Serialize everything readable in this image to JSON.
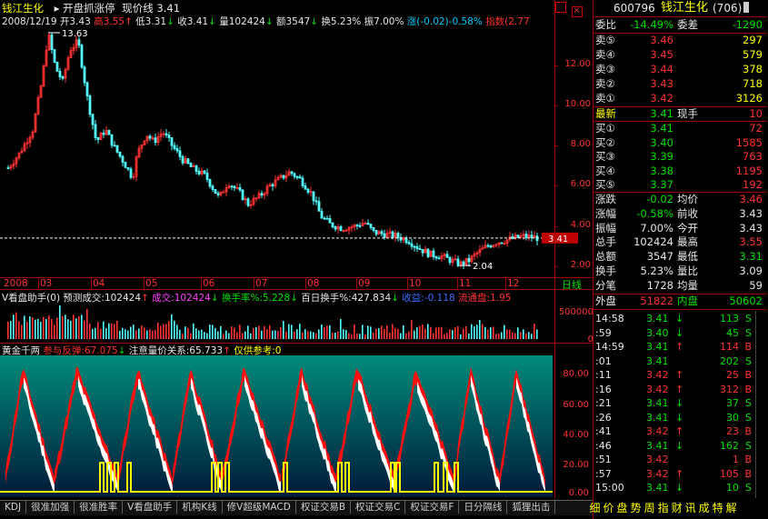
{
  "header": {
    "stock_name": "钱江生化",
    "indicator_name": "开盘抓涨停",
    "price_line_label": "现价线 3.41",
    "date": "2008/12/19",
    "open_label": "开3.43",
    "high_label": "高3.55",
    "low_label": "低3.31",
    "close_label": "收3.41",
    "volume_label": "量102424",
    "amount_label": "额3547",
    "turnover_label": "换5.23%",
    "amplitude_label": "振7.00%",
    "change_label": "涨(-0.02)-0.58%",
    "index_label": "指数(2.77"
  },
  "main_chart": {
    "high_annotation": "13.63",
    "low_annotation": "2.04",
    "current_price_tag": "3.41",
    "y_ticks": [
      "12.00",
      "10.00",
      "8.00",
      "6.00",
      "4.00",
      "2.00"
    ],
    "x_labels": [
      "2008",
      "03",
      "04",
      "05",
      "06",
      "07",
      "08",
      "09",
      "10",
      "11",
      "12"
    ],
    "period_label": "日线"
  },
  "volume_panel": {
    "title": "V看盘助手(0)",
    "items": [
      {
        "text": "预测成交:102424",
        "color": "#e8e8e8",
        "arrow": "↑"
      },
      {
        "text": "成交:102424",
        "color": "#ff40ff",
        "arrow": "↓"
      },
      {
        "text": "换手率%:5.228",
        "color": "#00e000",
        "arrow": "↓"
      },
      {
        "text": "百日换手%:427.834",
        "color": "#e8e8e8",
        "arrow": "↓"
      },
      {
        "text": "收益:-0.118",
        "color": "#3c6cff",
        "arrow": ""
      },
      {
        "text": "流通盘:1.95",
        "color": "#ff3232",
        "arrow": ""
      }
    ],
    "y_ticks": [
      "500000",
      "0"
    ]
  },
  "indicator_panel": {
    "title": "黄金千两",
    "items": [
      {
        "text": "参与反弹:67.075",
        "color": "#ff3232",
        "arrow": "↓"
      },
      {
        "text": "注意量价关系:65.733",
        "color": "#e8e8e8",
        "arrow": "↑"
      },
      {
        "text": "仅供参考:0",
        "color": "#ffff00",
        "arrow": ""
      }
    ],
    "y_ticks": [
      "80.00",
      "60.00",
      "40.00",
      "20.00",
      "0.00"
    ]
  },
  "bottom_tabs": [
    "KDJ",
    "很准加强",
    "很准胜率",
    "V看盘助手",
    "机构K线",
    "修V超级MACD",
    "权证交易B",
    "权证交易C",
    "权证交易F",
    "日分隔线",
    "狐狸出击"
  ],
  "function_tabs": [
    "细",
    "价",
    "盘",
    "势",
    "周",
    "指",
    "财",
    "讯",
    "成",
    "特",
    "解"
  ],
  "quote": {
    "code": "600796",
    "name": "钱江生化",
    "code_suffix": "(706)",
    "weibi_label": "委比",
    "weibi_value": "-14.49%",
    "weicha_label": "委差",
    "weicha_value": "-1290",
    "sells": [
      {
        "label": "卖⑤",
        "price": "3.46",
        "vol": "297"
      },
      {
        "label": "卖④",
        "price": "3.45",
        "vol": "579"
      },
      {
        "label": "卖③",
        "price": "3.44",
        "vol": "378"
      },
      {
        "label": "卖②",
        "price": "3.43",
        "vol": "718"
      },
      {
        "label": "卖①",
        "price": "3.42",
        "vol": "3126"
      }
    ],
    "latest_label": "最新",
    "latest_price": "3.41",
    "cur_vol_label": "现手",
    "cur_vol": "10",
    "buys": [
      {
        "label": "买①",
        "price": "3.41",
        "vol": "72"
      },
      {
        "label": "买②",
        "price": "3.40",
        "vol": "1585"
      },
      {
        "label": "买③",
        "price": "3.39",
        "vol": "763"
      },
      {
        "label": "买④",
        "price": "3.38",
        "vol": "1195"
      },
      {
        "label": "买⑤",
        "price": "3.37",
        "vol": "192"
      }
    ],
    "stats": [
      {
        "l1": "涨跌",
        "v1": "-0.02",
        "c1": "#00e000",
        "l2": "均价",
        "v2": "3.46",
        "c2": "#ff3232"
      },
      {
        "l1": "涨幅",
        "v1": "-0.58%",
        "c1": "#00e000",
        "l2": "前收",
        "v2": "3.43",
        "c2": "#e8e8e8"
      },
      {
        "l1": "振幅",
        "v1": "7.00%",
        "c1": "#e8e8e8",
        "l2": "今开",
        "v2": "3.43",
        "c2": "#e8e8e8"
      },
      {
        "l1": "总手",
        "v1": "102424",
        "c1": "#e8e8e8",
        "l2": "最高",
        "v2": "3.55",
        "c2": "#ff3232"
      },
      {
        "l1": "总额",
        "v1": "3547",
        "c1": "#e8e8e8",
        "l2": "最低",
        "v2": "3.31",
        "c2": "#00e000"
      },
      {
        "l1": "换手",
        "v1": "5.23%",
        "c1": "#e8e8e8",
        "l2": "量比",
        "v2": "3.09",
        "c2": "#e8e8e8"
      },
      {
        "l1": "分笔",
        "v1": "1728",
        "c1": "#e8e8e8",
        "l2": "均量",
        "v2": "59",
        "c2": "#e8e8e8"
      }
    ],
    "outer_label": "外盘",
    "outer_value": "51822",
    "inner_label": "内盘",
    "inner_value": "50602"
  },
  "ticks": [
    {
      "time": "14:58",
      "price": "3.41",
      "dir": "↓",
      "vol": "113",
      "side": "S"
    },
    {
      "time": ":59",
      "price": "3.40",
      "dir": "↓",
      "vol": "45",
      "side": "S"
    },
    {
      "time": "14:59",
      "price": "3.41",
      "dir": "↑",
      "vol": "114",
      "side": "B"
    },
    {
      "time": ":01",
      "price": "3.41",
      "dir": "",
      "vol": "202",
      "side": "S"
    },
    {
      "time": ":11",
      "price": "3.42",
      "dir": "↑",
      "vol": "25",
      "side": "B"
    },
    {
      "time": ":16",
      "price": "3.42",
      "dir": "↑",
      "vol": "312",
      "side": "B"
    },
    {
      "time": ":21",
      "price": "3.41",
      "dir": "↓",
      "vol": "37",
      "side": "S"
    },
    {
      "time": ":26",
      "price": "3.41",
      "dir": "↓",
      "vol": "30",
      "side": "S"
    },
    {
      "time": ":41",
      "price": "3.42",
      "dir": "↑",
      "vol": "23",
      "side": "B"
    },
    {
      "time": ":46",
      "price": "3.41",
      "dir": "↓",
      "vol": "162",
      "side": "S"
    },
    {
      "time": ":51",
      "price": "3.42",
      "dir": "",
      "vol": "1",
      "side": "B"
    },
    {
      "time": ":57",
      "price": "3.42",
      "dir": "↑",
      "vol": "105",
      "side": "B"
    },
    {
      "time": "15:00",
      "price": "3.41",
      "dir": "↓",
      "vol": "10",
      "side": "S"
    }
  ]
}
